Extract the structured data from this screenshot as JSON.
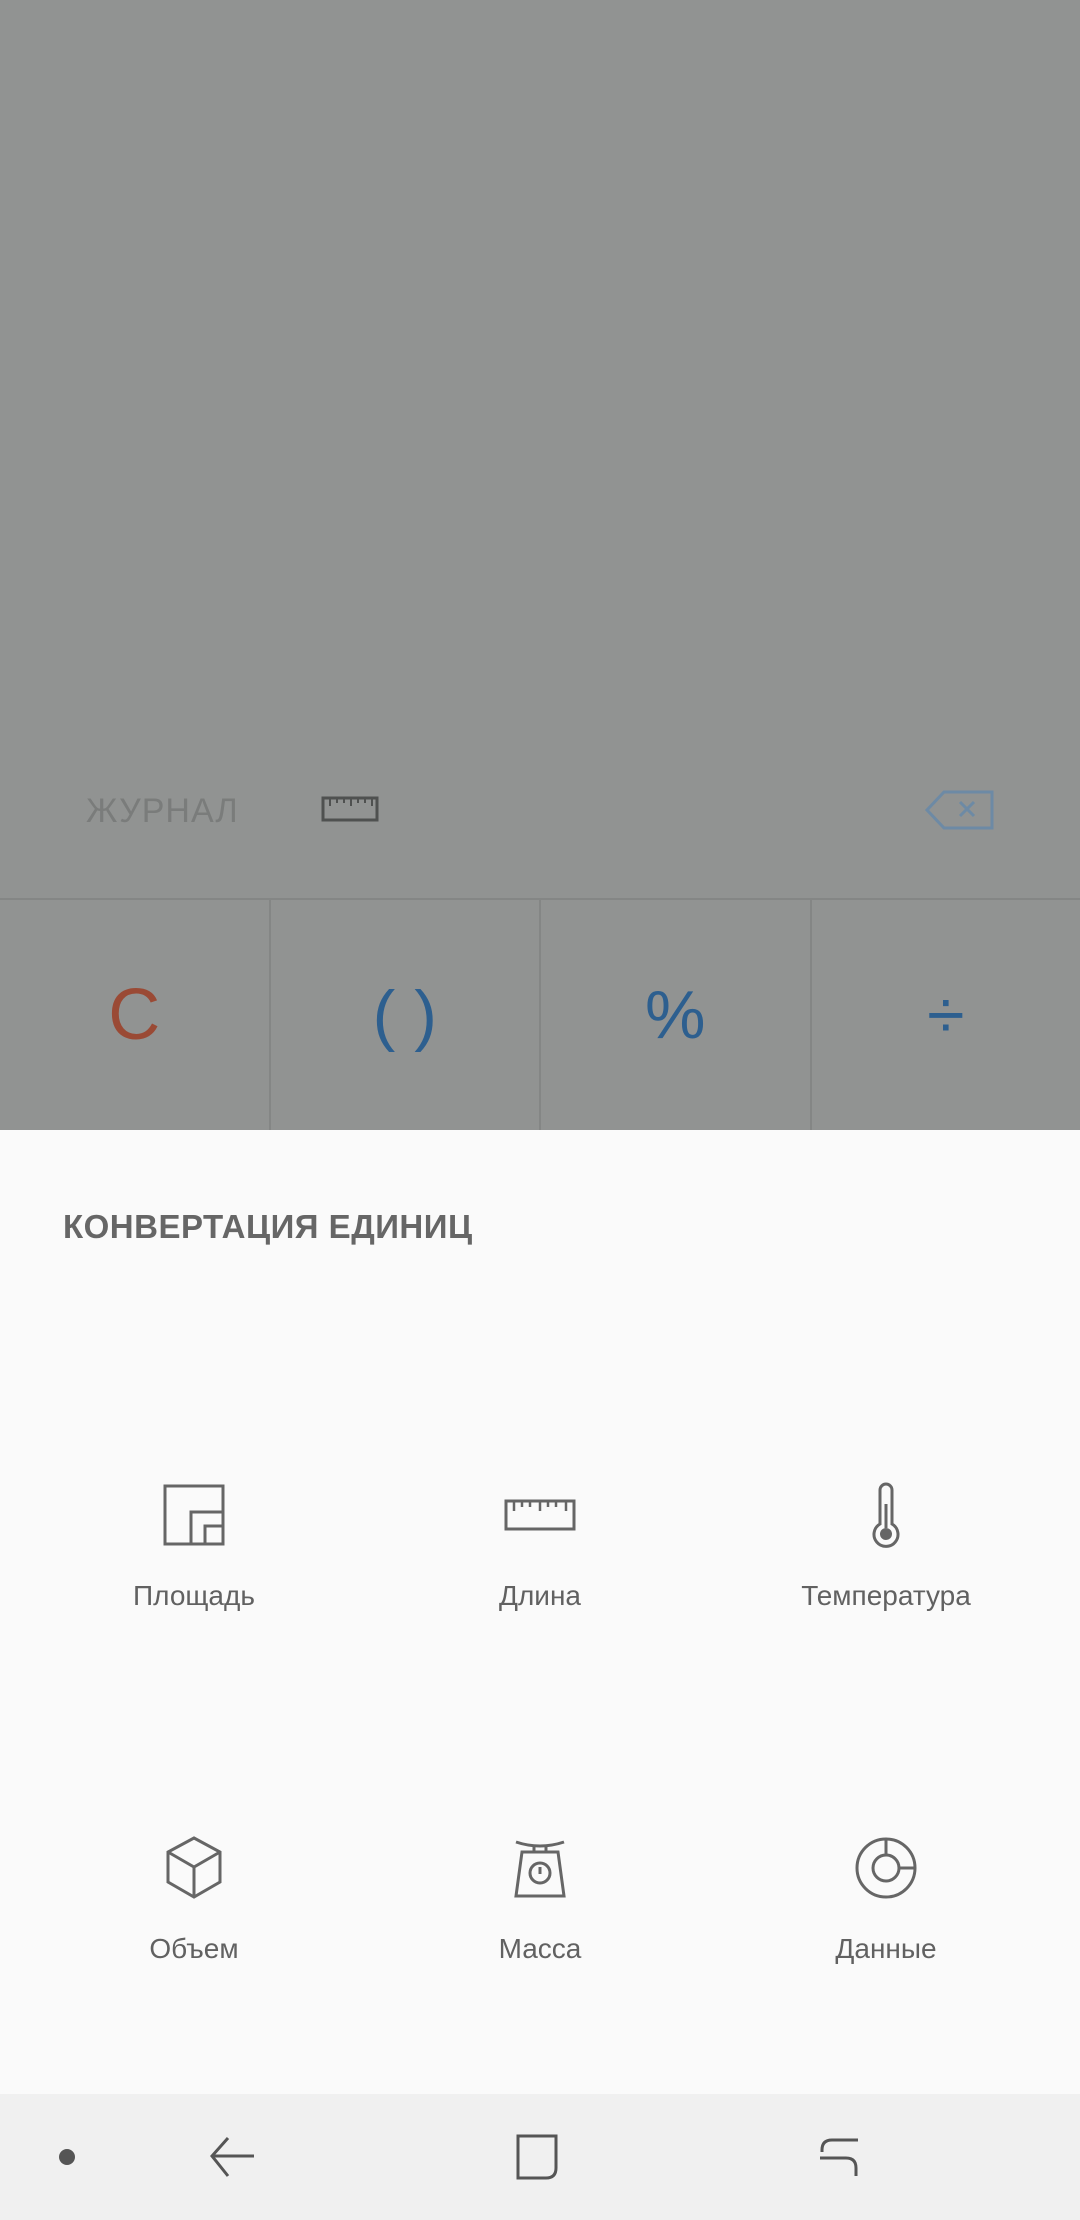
{
  "calculator": {
    "journal_label": "ЖУРНАЛ",
    "ruler_icon": "ruler-icon",
    "backspace_icon": "backspace-icon",
    "keys": [
      {
        "label": "C",
        "color": "#9a4a35"
      },
      {
        "label": "( )",
        "color": "#2d5f8f"
      },
      {
        "label": "%",
        "color": "#2d5f8f"
      },
      {
        "label": "÷",
        "color": "#2d5f8f"
      }
    ]
  },
  "sheet": {
    "title": "КОНВЕРТАЦИЯ ЕДИНИЦ",
    "units": [
      {
        "label": "Площадь",
        "icon": "area-icon"
      },
      {
        "label": "Длина",
        "icon": "length-icon"
      },
      {
        "label": "Температура",
        "icon": "thermometer-icon"
      },
      {
        "label": "Объем",
        "icon": "cube-icon"
      },
      {
        "label": "Масса",
        "icon": "scale-icon"
      },
      {
        "label": "Данные",
        "icon": "data-icon"
      }
    ]
  },
  "navbar": {
    "icons": [
      "dot-icon",
      "back-icon",
      "home-icon",
      "recents-icon"
    ]
  },
  "colors": {
    "dim_background": "#919392",
    "sheet_background": "#fafafa",
    "accent_blue": "#2d5f8f",
    "accent_red": "#9a4a35"
  }
}
